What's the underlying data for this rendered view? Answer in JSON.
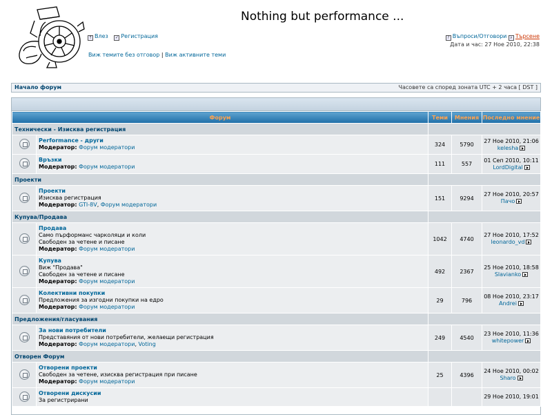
{
  "header": {
    "site_title": "Nothing but performance ...",
    "login_label": "Влез",
    "register_label": "Регистрация",
    "unanswered_label": "Виж темите без отговор",
    "separator": "|",
    "active_label": "Виж активните теми",
    "faq_label": "Въпроси/Отговори",
    "search_label": "Търсене",
    "datetime": "Дата и час: 27 Ное 2010, 22:38"
  },
  "nav": {
    "home_label": "Начало форум",
    "timezone": "Часовете са според зоната UTC + 2 часа [ DST ]"
  },
  "table": {
    "col_forum": "Форум",
    "col_topics": "Теми",
    "col_posts": "Мнения",
    "col_last": "Последно мнение",
    "moderators_label": "Модератор:"
  },
  "categories": [
    {
      "name": "Технически - Изисква регистрация",
      "forums": [
        {
          "name": "Performance - други",
          "desc": [],
          "moderators": [
            "Форум модератори"
          ],
          "topics": "324",
          "posts": "5790",
          "last_date": "27 Ное 2010, 21:06",
          "last_user": "kelesha"
        },
        {
          "name": "Връзки",
          "desc": [],
          "moderators": [
            "Форум модератори"
          ],
          "topics": "111",
          "posts": "557",
          "last_date": "01 Сеп 2010, 10:11",
          "last_user": "LordDigital"
        }
      ]
    },
    {
      "name": "Проекти",
      "forums": [
        {
          "name": "Проекти",
          "desc": [
            "Изисква регистрация"
          ],
          "moderators": [
            "GTI-8V",
            "Форум модератори"
          ],
          "topics": "151",
          "posts": "9294",
          "last_date": "27 Ное 2010, 20:57",
          "last_user": "Пачо"
        }
      ]
    },
    {
      "name": "Купува/Продава",
      "forums": [
        {
          "name": "Продава",
          "desc": [
            "Само пърформанс чарколяци и коли",
            "Свободен за четене и писане"
          ],
          "moderators": [
            "Форум модератори"
          ],
          "topics": "1042",
          "posts": "4740",
          "last_date": "27 Ное 2010, 17:52",
          "last_user": "leonardo_vd"
        },
        {
          "name": "Купува",
          "desc": [
            "Виж \"Продава\"",
            "Свободен за четене и писане"
          ],
          "moderators": [
            "Форум модератори"
          ],
          "topics": "492",
          "posts": "2367",
          "last_date": "25 Ное 2010, 18:58",
          "last_user": "Slavianko"
        },
        {
          "name": "Колективни покупки",
          "desc": [
            "Предложения за изгодни покупки на едро"
          ],
          "moderators": [
            "Форум модератори"
          ],
          "topics": "29",
          "posts": "796",
          "last_date": "08 Ное 2010, 23:17",
          "last_user": "Andrei"
        }
      ]
    },
    {
      "name": "Предложения/гласувания",
      "forums": [
        {
          "name": "За нови потребители",
          "desc": [
            "Представяния от нови потребители, желаещи регистрация"
          ],
          "moderators": [
            "Форум модератори",
            "Voting"
          ],
          "topics": "249",
          "posts": "4540",
          "last_date": "23 Ное 2010, 11:36",
          "last_user": "whitepower"
        }
      ]
    },
    {
      "name": "Отворен Форум",
      "forums": [
        {
          "name": "Отворени проекти",
          "desc": [
            "Свободен за четене, изисква регистрация при писане"
          ],
          "moderators": [
            "Форум модератори"
          ],
          "topics": "25",
          "posts": "4396",
          "last_date": "24 Ное 2010, 00:02",
          "last_user": "Sharo"
        },
        {
          "name": "Отворени дискусии",
          "desc": [
            "За регистрирани"
          ],
          "moderators": [],
          "topics": "",
          "posts": "",
          "last_date": "29 Ное 2010, 19:01",
          "last_user": ""
        }
      ]
    }
  ]
}
